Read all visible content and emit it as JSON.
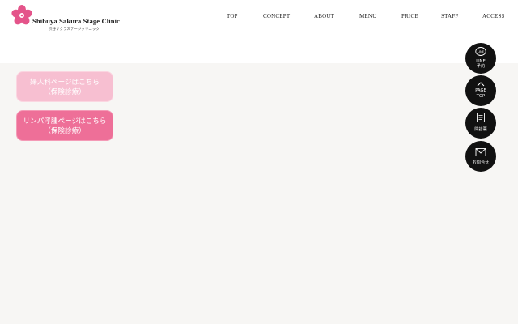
{
  "header": {
    "logo_name": "Shibuya Sakura Stage Clinic",
    "logo_sub": "渋谷サクラステージクリニック"
  },
  "nav": {
    "items": [
      {
        "label": "TOP"
      },
      {
        "label": "CONCEPT"
      },
      {
        "label": "ABOUT"
      },
      {
        "label": "MENU"
      },
      {
        "label": "PRICE"
      },
      {
        "label": "STAFF"
      },
      {
        "label": "ACCESS"
      }
    ]
  },
  "links": [
    {
      "line1": "婦人科ページはこちら",
      "line2": "（保険診療）"
    },
    {
      "line1": "リンパ浮腫ページはこちら",
      "line2": "（保険診療）"
    }
  ],
  "side_buttons": [
    {
      "icon": "line-icon",
      "icon_text": "LINE",
      "line1": "LINE",
      "line2": "予約"
    },
    {
      "icon": "chevron-up-icon",
      "line1": "PAGE",
      "line2": "TOP"
    },
    {
      "icon": "questionnaire-icon",
      "line1": "問診票"
    },
    {
      "icon": "mail-icon",
      "line1": "お問合せ"
    }
  ],
  "colors": {
    "brand_pink": "#e4548a",
    "pill_light": "#f7bfd1",
    "pill_dark": "#ee6f98",
    "side_button": "#111111",
    "background": "#f7f6f4"
  }
}
